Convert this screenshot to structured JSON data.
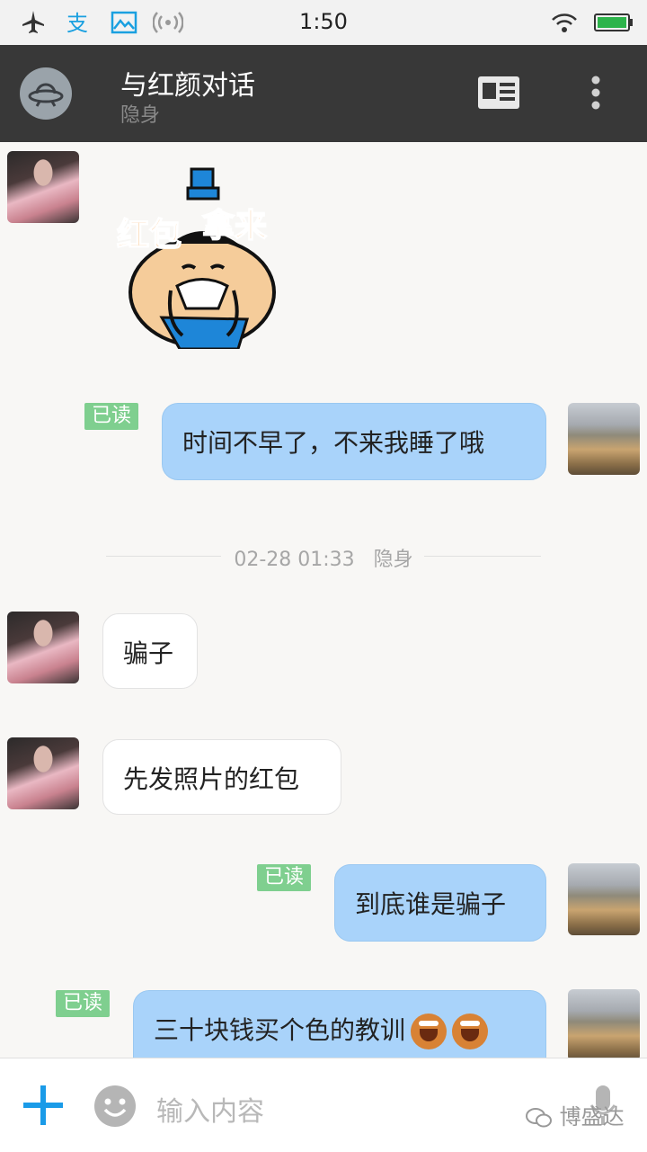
{
  "status_bar": {
    "time": "1:50",
    "icons": [
      "airplane-icon",
      "alipay-icon",
      "gallery-icon",
      "signal-icon",
      "wifi-icon",
      "battery-icon"
    ],
    "colors": {
      "alipay": "#1aa0e0",
      "gallery": "#1aa0e0",
      "battery": "#2db44b"
    }
  },
  "header": {
    "title": "与红颜对话",
    "subtitle": "隐身",
    "background": "#383838"
  },
  "messages": {
    "sticker": {
      "lines": [
        "红包",
        "拿来"
      ]
    },
    "m1": {
      "text": "时间不早了，不来我睡了哦",
      "read": "已读"
    },
    "divider": {
      "time": "02-28 01:33",
      "status": "隐身"
    },
    "m2": {
      "text": "骗子"
    },
    "m3": {
      "text": "先发照片的红包"
    },
    "m4": {
      "text": "到底谁是骗子",
      "read": "已读"
    },
    "m5": {
      "text": "三十块钱买个色的教训",
      "read": "已读",
      "emojis": [
        "laughing-emoji",
        "laughing-emoji"
      ]
    }
  },
  "input": {
    "placeholder": "输入内容"
  },
  "watermark": "博盛达",
  "colors": {
    "accent": "#1a9be8",
    "outgoing_bubble": "#a9d3fa",
    "read_badge": "#7fcf8f"
  }
}
